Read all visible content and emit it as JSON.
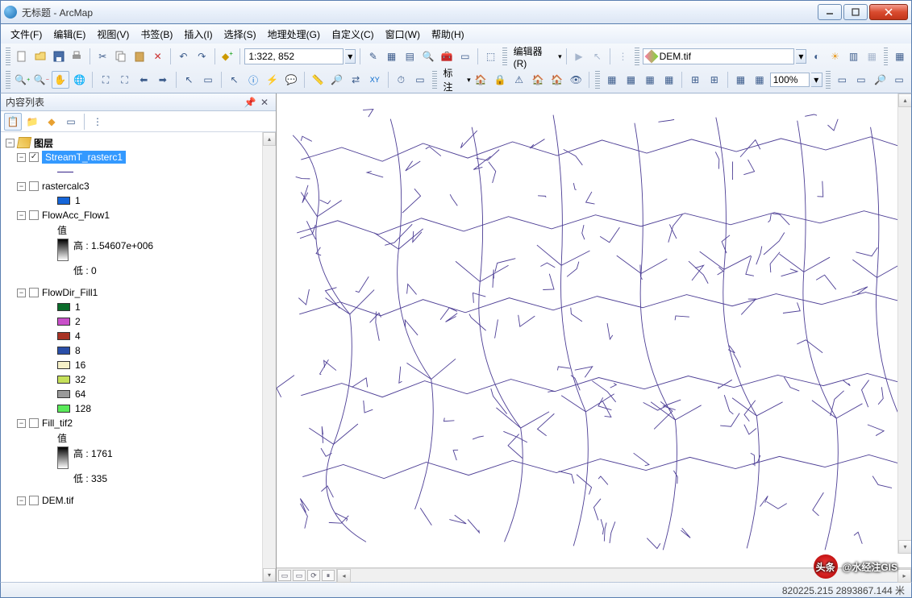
{
  "window": {
    "title": "无标题 - ArcMap"
  },
  "menu": {
    "file": "文件(F)",
    "edit": "编辑(E)",
    "view": "视图(V)",
    "bookmarks": "书签(B)",
    "insert": "插入(I)",
    "selection": "选择(S)",
    "geoprocessing": "地理处理(G)",
    "customize": "自定义(C)",
    "windows": "窗口(W)",
    "help": "帮助(H)"
  },
  "toolbar": {
    "scale_value": "1:322, 852",
    "editor_label": "编辑器(R)",
    "dem_value": "DEM.tif",
    "label_tool": "标注",
    "zoom_value": "100%"
  },
  "toc": {
    "title": "内容列表",
    "root": "图层",
    "layers": {
      "stream": "StreamT_rasterc1",
      "rastercalc": "rastercalc3",
      "rastercalc_val": "1",
      "flowacc": "FlowAcc_Flow1",
      "flowacc_label": "值",
      "flowacc_high": "高 : 1.54607e+006",
      "flowacc_low": "低 : 0",
      "flowdir": "FlowDir_Fill1",
      "flowdir_vals": [
        "1",
        "2",
        "4",
        "8",
        "16",
        "32",
        "64",
        "128"
      ],
      "flowdir_colors": [
        "#0a6b2a",
        "#c94fc9",
        "#a83224",
        "#2a4fa8",
        "#f5f0c8",
        "#c5e05a",
        "#999999",
        "#5aea5a"
      ],
      "fill": "Fill_tif2",
      "fill_label": "值",
      "fill_high": "高 : 1761",
      "fill_low": "低 : 335",
      "dem": "DEM.tif"
    }
  },
  "status": {
    "coords": "820225.215  2893867.144 米"
  },
  "watermark": {
    "prefix": "头条",
    "text": "@水经注GIS"
  }
}
